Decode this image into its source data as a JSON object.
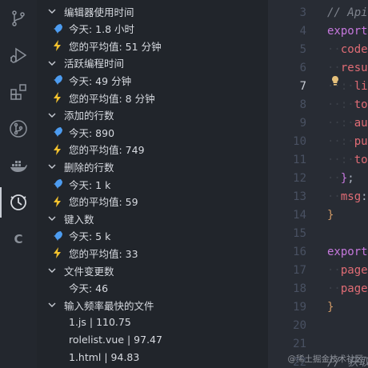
{
  "panel": {
    "groups": [
      {
        "label": "编辑器使用时间",
        "items": [
          {
            "icon": "rocket",
            "text": "今天: 1.8 小时"
          },
          {
            "icon": "bolt",
            "text": "您的平均值: 51 分钟"
          }
        ]
      },
      {
        "label": "活跃编程时间",
        "items": [
          {
            "icon": "rocket",
            "text": "今天: 49 分钟"
          },
          {
            "icon": "bolt",
            "text": "您的平均值: 8 分钟"
          }
        ]
      },
      {
        "label": "添加的行数",
        "items": [
          {
            "icon": "rocket",
            "text": "今天: 890"
          },
          {
            "icon": "bolt",
            "text": "您的平均值: 749"
          }
        ]
      },
      {
        "label": "删除的行数",
        "items": [
          {
            "icon": "rocket",
            "text": "今天: 1 k"
          },
          {
            "icon": "bolt",
            "text": "您的平均值: 59"
          }
        ]
      },
      {
        "label": "键入数",
        "items": [
          {
            "icon": "rocket",
            "text": "今天: 5 k"
          },
          {
            "icon": "bolt",
            "text": "您的平均值: 33"
          }
        ]
      },
      {
        "label": "文件变更数",
        "items": [
          {
            "icon": "none",
            "text": "今天: 46"
          }
        ]
      },
      {
        "label": "输入频率最快的文件",
        "items": [
          {
            "icon": "none",
            "text": "1.js | 110.75"
          },
          {
            "icon": "none",
            "text": "rolelist.vue | 97.47"
          },
          {
            "icon": "none",
            "text": "1.html | 94.83"
          }
        ]
      },
      {
        "label": "输入最多的文件",
        "items": []
      }
    ]
  },
  "editor": {
    "current_line": "7",
    "lines": [
      {
        "n": "3",
        "tokens": [
          {
            "c": "cm",
            "t": "// Api"
          }
        ]
      },
      {
        "n": "4",
        "tokens": [
          {
            "c": "kw",
            "t": "export"
          }
        ]
      },
      {
        "n": "5",
        "tokens": [
          {
            "c": "guide",
            "t": "··"
          },
          {
            "c": "prop",
            "t": "code"
          }
        ]
      },
      {
        "n": "6",
        "tokens": [
          {
            "c": "guide",
            "t": "··"
          },
          {
            "c": "prop",
            "t": "resul"
          }
        ]
      },
      {
        "n": "7",
        "tokens": [
          {
            "c": "guide",
            "t": "··:·"
          },
          {
            "c": "prop",
            "t": "li"
          }
        ]
      },
      {
        "n": "8",
        "tokens": [
          {
            "c": "guide",
            "t": "··:·"
          },
          {
            "c": "prop",
            "t": "to"
          }
        ]
      },
      {
        "n": "9",
        "tokens": [
          {
            "c": "guide",
            "t": "··:·"
          },
          {
            "c": "prop",
            "t": "au"
          }
        ]
      },
      {
        "n": "10",
        "tokens": [
          {
            "c": "guide",
            "t": "··:·"
          },
          {
            "c": "prop",
            "t": "pu"
          }
        ]
      },
      {
        "n": "11",
        "tokens": [
          {
            "c": "guide",
            "t": "··:·"
          },
          {
            "c": "prop",
            "t": "to"
          }
        ]
      },
      {
        "n": "12",
        "tokens": [
          {
            "c": "guide",
            "t": "··"
          },
          {
            "c": "kw",
            "t": "}"
          },
          {
            "c": "pl",
            "t": ";"
          }
        ]
      },
      {
        "n": "13",
        "tokens": [
          {
            "c": "guide",
            "t": "··"
          },
          {
            "c": "prop",
            "t": "msg"
          },
          {
            "c": "pl",
            "t": ":"
          }
        ]
      },
      {
        "n": "14",
        "tokens": [
          {
            "c": "br",
            "t": "}"
          }
        ]
      },
      {
        "n": "15",
        "tokens": []
      },
      {
        "n": "16",
        "tokens": [
          {
            "c": "kw",
            "t": "export"
          }
        ]
      },
      {
        "n": "17",
        "tokens": [
          {
            "c": "guide",
            "t": "··"
          },
          {
            "c": "prop",
            "t": "page"
          }
        ]
      },
      {
        "n": "18",
        "tokens": [
          {
            "c": "guide",
            "t": "··"
          },
          {
            "c": "prop",
            "t": "page"
          }
        ]
      },
      {
        "n": "19",
        "tokens": [
          {
            "c": "br",
            "t": "}"
          }
        ]
      },
      {
        "n": "20",
        "tokens": []
      },
      {
        "n": "21",
        "tokens": []
      },
      {
        "n": "22",
        "tokens": [
          {
            "c": "cm",
            "t": "// 获取"
          }
        ]
      }
    ],
    "watermark": "@稀土掘金技术社区"
  },
  "activity_bar": {
    "items": [
      "source-control-icon",
      "run-debug-icon",
      "extensions-icon",
      "pull-request-icon",
      "docker-icon",
      "code-time-icon",
      "c-extension-icon"
    ],
    "active": "code-time-icon",
    "c_label": "C"
  },
  "colors": {
    "rocket": "#4d9cf0",
    "bolt": "#f2c12e",
    "icon_gray": "#8b919a"
  }
}
